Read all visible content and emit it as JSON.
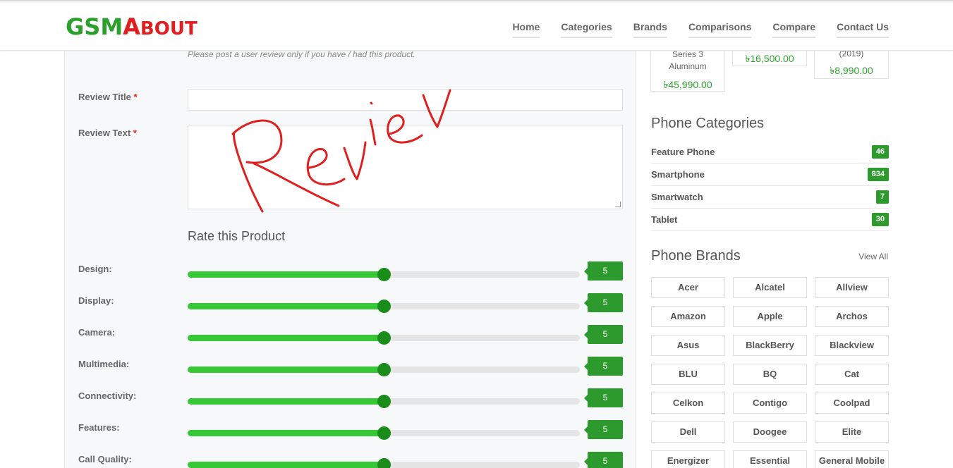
{
  "header": {
    "logo_text_1": "GSM",
    "logo_text_2": "A",
    "logo_text_3": "BOUT",
    "nav": [
      "Home",
      "Categories",
      "Brands",
      "Comparisons",
      "Compare",
      "Contact Us"
    ]
  },
  "form": {
    "note": "Please post a user review only if you have / had this product.",
    "review_title_label": "Review Title",
    "review_text_label": "Review Text",
    "required_mark": "*",
    "title_value": "",
    "text_value": "",
    "handwritten_annotation": "Review",
    "rate_title": "Rate this Product",
    "ratings": [
      {
        "label": "Design:",
        "value": "5",
        "level": 0.5
      },
      {
        "label": "Display:",
        "value": "5",
        "level": 0.5
      },
      {
        "label": "Camera:",
        "value": "5",
        "level": 0.5
      },
      {
        "label": "Multimedia:",
        "value": "5",
        "level": 0.5
      },
      {
        "label": "Connectivity:",
        "value": "5",
        "level": 0.5
      },
      {
        "label": "Features:",
        "value": "5",
        "level": 0.5
      },
      {
        "label": "Call Quality:",
        "value": "5",
        "level": 0.5
      }
    ]
  },
  "sidebar": {
    "products": [
      {
        "name_1": "Series 3",
        "name_2": "Aluminum",
        "price": "৳45,990.00"
      },
      {
        "price": "৳16,500.00"
      },
      {
        "name_1": "(2019)",
        "price": "৳8,990.00"
      }
    ],
    "categories_title": "Phone Categories",
    "categories": [
      {
        "name": "Feature Phone",
        "count": "46"
      },
      {
        "name": "Smartphone",
        "count": "834"
      },
      {
        "name": "Smartwatch",
        "count": "7"
      },
      {
        "name": "Tablet",
        "count": "30"
      }
    ],
    "brands_title": "Phone Brands",
    "view_all": "View All",
    "brands": [
      "Acer",
      "Alcatel",
      "Allview",
      "Amazon",
      "Apple",
      "Archos",
      "Asus",
      "BlackBerry",
      "Blackview",
      "BLU",
      "BQ",
      "Cat",
      "Celkon",
      "Contigo",
      "Coolpad",
      "Dell",
      "Doogee",
      "Elite",
      "Energizer",
      "Essential",
      "General Mobile"
    ]
  },
  "colors": {
    "accent_green": "#2d9a2d",
    "slider_fill": "#37c837",
    "slider_knob": "#1a8c1a",
    "logo_red": "#e02020",
    "annotation_red": "#e02020"
  }
}
